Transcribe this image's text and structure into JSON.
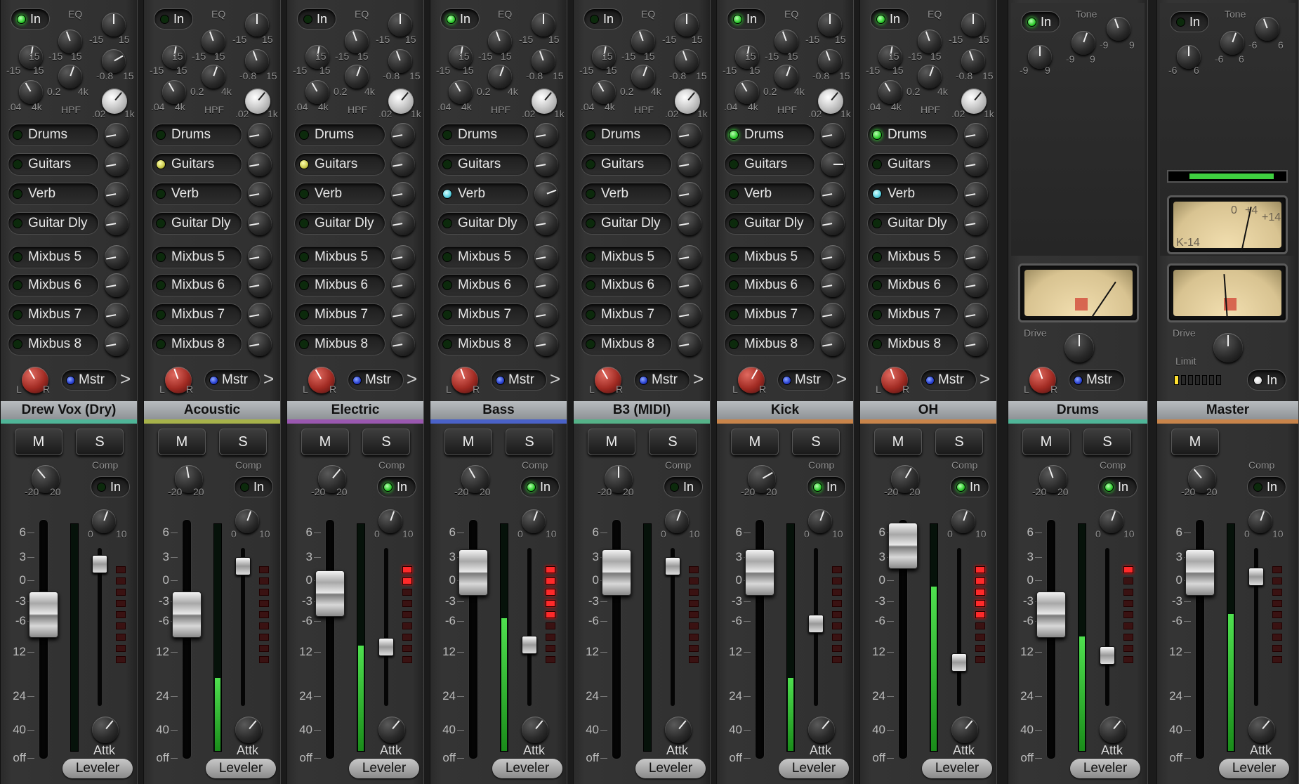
{
  "labels": {
    "in": "In",
    "eq": "EQ",
    "tone": "Tone",
    "hpf": "HPF",
    "mstr": "Mstr",
    "mute": "M",
    "solo": "S",
    "comp": "Comp",
    "attk": "Attk",
    "leveler": "Leveler",
    "drive": "Drive",
    "limit": "Limit",
    "pan_l": "L",
    "pan_r": "R",
    "arrow": ">",
    "gain_min": "-20",
    "gain_max": "20",
    "atk_min": "0",
    "atk_max": "10",
    "eq_n15": "-15",
    "eq_15": "15",
    "eq_n8": "-0.8",
    "eq_02": "0.2",
    "eq_4k": "4k",
    "eq_04": ".04",
    "eq_02b": ".02",
    "eq_1k": "1k",
    "tone_n9": "-9",
    "tone_9": "9",
    "tone_n6": "-6",
    "tone_6": "6",
    "vu_k14": "K-14",
    "vu_0": "0",
    "vu_p4": "+4",
    "vu_p14": "+14"
  },
  "fader_scale": [
    "6",
    "3",
    "0",
    "-3",
    "-6",
    "12",
    "24",
    "40",
    "off"
  ],
  "sends": [
    "Drums",
    "Guitars",
    "Verb",
    "Guitar Dly",
    "Mixbus 5",
    "Mixbus 6",
    "Mixbus 7",
    "Mixbus 8"
  ],
  "channels": [
    {
      "name": "Drew Vox (Dry)",
      "color": "#4fb598",
      "eq_in": true,
      "comp_in": false,
      "fader_db": -6,
      "meter": 0.0,
      "gr_lit": 0,
      "send_leds": [
        "off",
        "off",
        "off",
        "off",
        "off",
        "off",
        "off",
        "off"
      ]
    },
    {
      "name": "Acoustic",
      "color": "#a7b24a",
      "eq_in": false,
      "comp_in": false,
      "fader_db": -6,
      "meter": 0.32,
      "gr_lit": 0,
      "send_leds": [
        "off",
        "yellow",
        "off",
        "off",
        "off",
        "off",
        "off",
        "off"
      ]
    },
    {
      "name": "Electric",
      "color": "#9a58b0",
      "eq_in": false,
      "comp_in": true,
      "fader_db": -3,
      "meter": 0.46,
      "gr_lit": 2,
      "send_leds": [
        "off",
        "yellow",
        "off",
        "off",
        "off",
        "off",
        "off",
        "off"
      ]
    },
    {
      "name": "Bass",
      "color": "#4a62c8",
      "eq_in": true,
      "comp_in": true,
      "fader_db": 0,
      "meter": 0.58,
      "gr_lit": 5,
      "send_leds": [
        "off",
        "off",
        "cyan",
        "off",
        "off",
        "off",
        "off",
        "off"
      ]
    },
    {
      "name": "B3 (MIDI)",
      "color": "#55b288",
      "eq_in": false,
      "comp_in": false,
      "fader_db": 0,
      "meter": 0.0,
      "gr_lit": 0,
      "send_leds": [
        "off",
        "off",
        "off",
        "off",
        "off",
        "off",
        "off",
        "off"
      ]
    },
    {
      "name": "Kick",
      "color": "#c8844a",
      "eq_in": true,
      "comp_in": true,
      "fader_db": 0,
      "meter": 0.32,
      "gr_lit": 0,
      "send_leds": [
        "on",
        "off",
        "off",
        "off",
        "off",
        "off",
        "off",
        "off"
      ]
    },
    {
      "name": "OH",
      "color": "#c8844a",
      "eq_in": true,
      "comp_in": true,
      "fader_db": 6,
      "meter": 0.72,
      "gr_lit": 5,
      "send_leds": [
        "on",
        "off",
        "cyan",
        "off",
        "off",
        "off",
        "off",
        "off"
      ]
    }
  ],
  "buses": [
    {
      "name": "Drums",
      "color": "#4fb598",
      "tone_in": true,
      "comp_in": true,
      "fader_db": -6,
      "meter": 0.5,
      "gr_lit": 1
    },
    {
      "name": "Master",
      "color": "#c8844a",
      "tone_in": false,
      "comp_in": false,
      "fader_db": 0,
      "meter": 0.6,
      "gr_lit": 0
    }
  ]
}
